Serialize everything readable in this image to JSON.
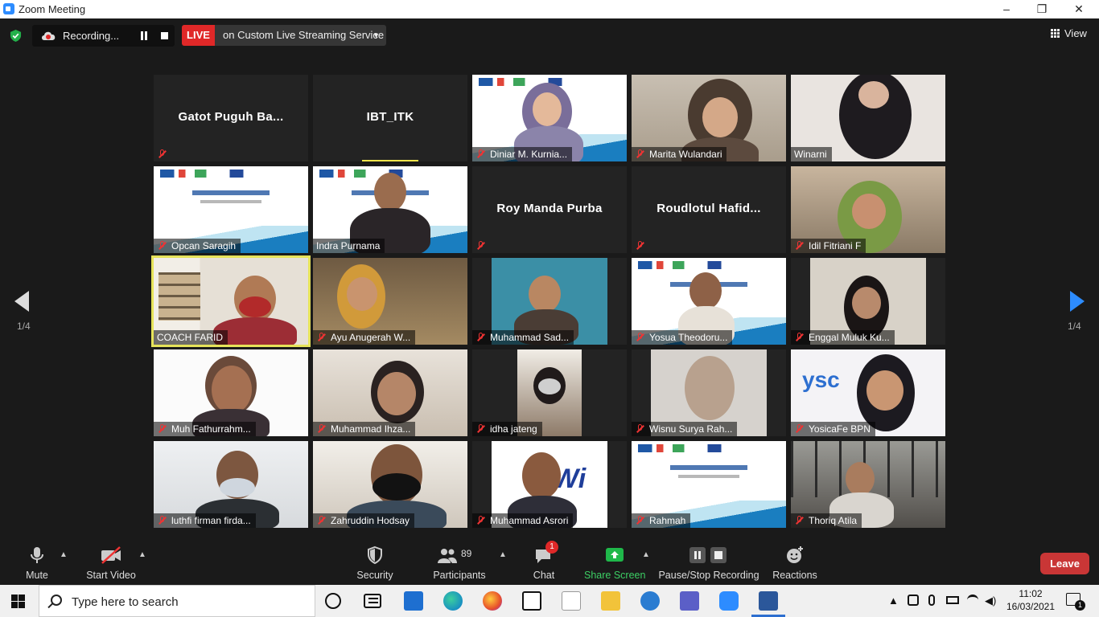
{
  "window": {
    "title": "Zoom Meeting",
    "minimize": "–",
    "maximize": "❐",
    "close": "✕"
  },
  "topbar": {
    "recording_label": "Recording...",
    "live_badge": "LIVE",
    "live_service": "on Custom Live Streaming Service",
    "view_label": "View"
  },
  "gallery": {
    "page_left": "1/4",
    "page_right": "1/4",
    "tiles": [
      {
        "name": "Gatot  Puguh  Ba...",
        "muted": true,
        "video": false
      },
      {
        "name": "IBT_ITK",
        "muted": false,
        "video": false
      },
      {
        "name": "Diniar M. Kurnia...",
        "muted": true,
        "video": true
      },
      {
        "name": "Marita Wulandari",
        "muted": true,
        "video": true
      },
      {
        "name": "Winarni",
        "muted": false,
        "video": true
      },
      {
        "name": "Opcan Saragih",
        "muted": true,
        "video": true
      },
      {
        "name": "Indra Purnama",
        "muted": false,
        "video": true
      },
      {
        "name": "Roy Manda Purba",
        "muted": true,
        "video": false
      },
      {
        "name": "Roudlotul  Hafid...",
        "muted": true,
        "video": false
      },
      {
        "name": "Idil Fitriani F",
        "muted": true,
        "video": true
      },
      {
        "name": "COACH FARID",
        "muted": false,
        "video": true
      },
      {
        "name": "Ayu Anugerah W...",
        "muted": true,
        "video": true
      },
      {
        "name": "Muhammad Sad...",
        "muted": true,
        "video": true
      },
      {
        "name": "Yosua Theodoru...",
        "muted": true,
        "video": true
      },
      {
        "name": "Enggal Muluk Ku...",
        "muted": true,
        "video": true
      },
      {
        "name": "Muh Fathurrahm...",
        "muted": true,
        "video": true
      },
      {
        "name": "Muhammad Ihza...",
        "muted": true,
        "video": true
      },
      {
        "name": "idha jateng",
        "muted": true,
        "video": true
      },
      {
        "name": "Wisnu Surya Rah...",
        "muted": true,
        "video": true
      },
      {
        "name": "YosicaFe BPN",
        "muted": true,
        "video": true
      },
      {
        "name": "luthfi firman firda...",
        "muted": true,
        "video": true
      },
      {
        "name": "Zahruddin Hodsay",
        "muted": true,
        "video": true
      },
      {
        "name": "Muhammad Asrori",
        "muted": true,
        "video": true
      },
      {
        "name": "Rahmah",
        "muted": true,
        "video": true
      },
      {
        "name": "Thoriq Atila",
        "muted": true,
        "video": true
      }
    ]
  },
  "toolbar": {
    "mute": "Mute",
    "start_video": "Start Video",
    "security": "Security",
    "participants": "Participants",
    "participants_count": "89",
    "chat": "Chat",
    "chat_badge": "1",
    "share_screen": "Share Screen",
    "pause_stop": "Pause/Stop Recording",
    "reactions": "Reactions",
    "leave": "Leave"
  },
  "taskbar": {
    "search_placeholder": "Type here to search",
    "time": "11:02",
    "date": "16/03/2021",
    "notifications": "1"
  },
  "colors": {
    "accent": "#2d8cff",
    "live": "#e02828",
    "leave": "#c93636",
    "share": "#1fb84a",
    "active_speaker": "#e6e35a"
  }
}
